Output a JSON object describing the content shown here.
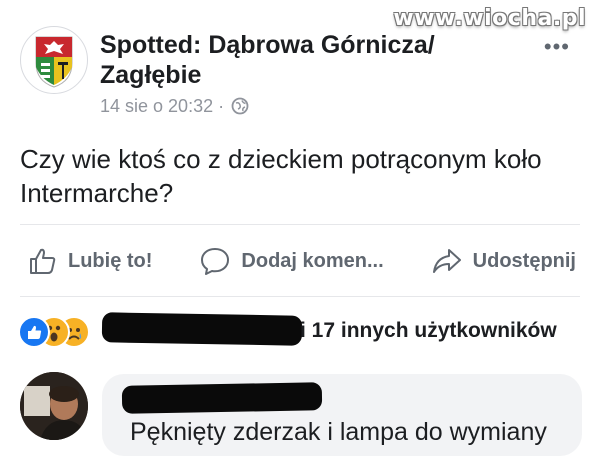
{
  "watermark": "www.wiocha.pl",
  "post": {
    "page_name_line1": "Spotted: Dąbrowa Górnicza/",
    "page_name_line2": "Zagłębie",
    "timestamp": "14 sie o 20:32",
    "meta_separator": "·",
    "more_icon": "more-dots-icon",
    "text_line1": "Czy wie ktoś co z dzieckiem potrąconym koło",
    "text_line2": "Intermarche?"
  },
  "actions": {
    "like_label": "Lubię to!",
    "comment_label": "Dodaj komen...",
    "share_label": "Udostępnij"
  },
  "reactions": {
    "icons": [
      "like-icon",
      "wow-icon",
      "sad-icon"
    ],
    "summary_suffix": "i 17 innych użytkowników"
  },
  "comment": {
    "text": "Pęknięty zderzak i lampa do wymiany"
  },
  "colors": {
    "accent": "#1877f2",
    "text": "#1c1e21",
    "muted": "#606770",
    "meta": "#90949c",
    "bubble": "#f2f3f5"
  }
}
